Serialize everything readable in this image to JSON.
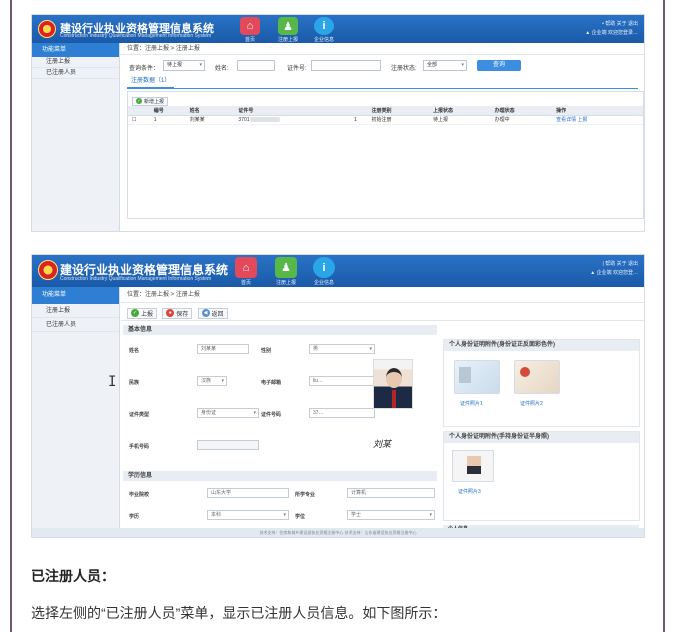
{
  "app": {
    "title": "建设行业执业资格管理信息系统",
    "subtitle": "Construction Industry Qualification Management Information System"
  },
  "nav": [
    {
      "label": "首页",
      "icon": "home-icon",
      "glyph": "⌂"
    },
    {
      "label": "注册上报",
      "icon": "register-icon",
      "glyph": "♟"
    },
    {
      "label": "企业信息",
      "icon": "info-icon",
      "glyph": "i"
    }
  ],
  "header_right": {
    "shot1": {
      "line1": "• 帮助  关于  退出",
      "line2": "▲ 企业端  欢迎您登录…"
    },
    "shot2": {
      "line1": "| 帮助  关于  退出",
      "line2": "▲ 企业端  欢迎您登…"
    }
  },
  "sidebar": {
    "title": "功能菜单",
    "items": [
      {
        "label": "注册上报"
      },
      {
        "label": "已注册人员"
      }
    ]
  },
  "shot1": {
    "breadcrumb": "位置：注册上报 > 注册上报",
    "filter": {
      "condition_label": "查询条件：",
      "condition_value": "待上报",
      "name_label": "姓名:",
      "cert_label": "证件号:",
      "status_label": "注册状态:",
      "status_value": "全部",
      "search_button": "查询"
    },
    "tab": "注册数据（1）",
    "add_button": "新增上报",
    "table": {
      "headers": [
        "",
        "编号",
        "姓名",
        "证件号",
        "",
        "注册类别",
        "上报状态",
        "办理状态",
        "操作"
      ],
      "rows": [
        [
          "☐",
          "1",
          "刘某某",
          "3701",
          "1",
          "初始注册",
          "待上报",
          "办理中",
          "查看详情 上报"
        ]
      ]
    }
  },
  "shot2": {
    "breadcrumb": "位置：注册上报 > 注册上报",
    "toolbar": [
      {
        "label": "上报",
        "color": "#48a93c",
        "glyph": "✓"
      },
      {
        "label": "保存",
        "color": "#d9473a",
        "glyph": "●"
      },
      {
        "label": "返回",
        "color": "#5a8fd0",
        "glyph": "◀"
      }
    ],
    "basic_section": "基本信息",
    "fields": {
      "name_label": "姓名",
      "name_value": "刘某某",
      "gender_label": "性别",
      "gender_value": "男",
      "ethnicity_label": "民族",
      "ethnicity_value": "汉族",
      "email_label": "电子邮箱",
      "email_value": "liu…",
      "idtype_label": "证件类型",
      "idtype_value": "身份证",
      "idno_label": "证件号码",
      "idno_value": "37…",
      "phone_label": "手机号码",
      "edu_section": "学历信息",
      "school_label": "毕业院校",
      "school_value": "山东大学",
      "major_label": "所学专业",
      "major_value": "计算机",
      "degree_label": "学历",
      "degree_value": "本科",
      "degree2_label": "学位",
      "degree2_value": "学士"
    },
    "signature": "刘某",
    "id_panel": {
      "title": "个人身份证明附件(身份证正反面彩色件)",
      "front_label": "证件照片1",
      "back_label": "证件照片2"
    },
    "cert_panel": {
      "title": "个人身份证明附件(手持身份证半身照)",
      "photo_label": "证件照片3",
      "next_section": "个人信息"
    },
    "footer": "技术支持：住房和城乡建设部执业资格注册中心  技术支持：山东省建设执业资格注册中心"
  },
  "article": {
    "heading": "已注册人员：",
    "paragraph": "选择左侧的“已注册人员”菜单，显示已注册人员信息。如下图所示："
  }
}
